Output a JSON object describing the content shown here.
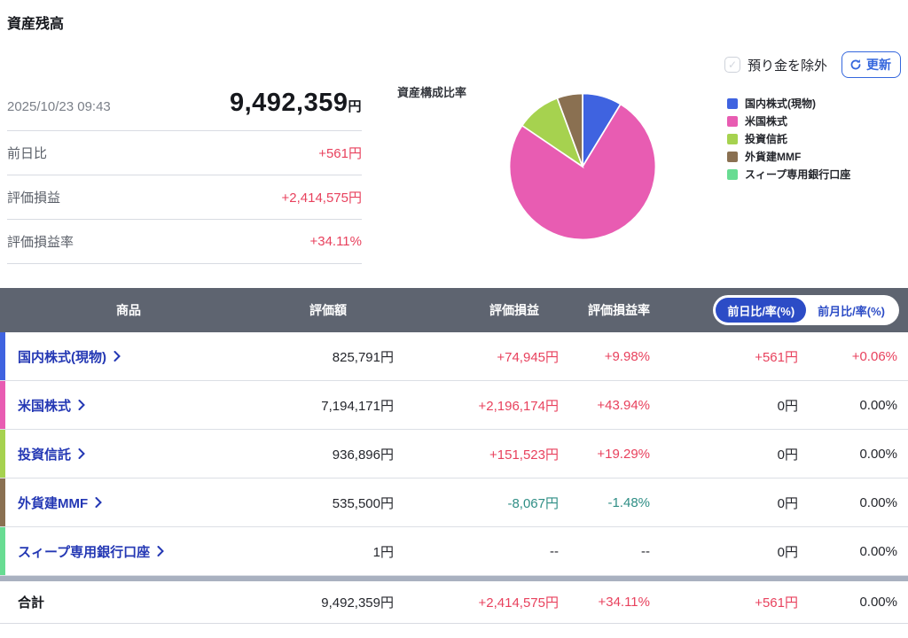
{
  "colors": {
    "positive": "#e8415d",
    "negative": "#2f8e85",
    "link": "#2438b4",
    "accent-blue": "#3567dd",
    "pill-blue": "#2c4cc6",
    "header-bg": "#5e6470"
  },
  "page": {
    "title": "資産残高"
  },
  "controls": {
    "exclude_label": "預り金を除外",
    "refresh_label": "更新"
  },
  "summary": {
    "datetime": "2025/10/23 09:43",
    "total_amount": "9,492,359",
    "currency_suffix": "円",
    "rows": [
      {
        "label": "前日比",
        "value": "+561円",
        "tone": "pos"
      },
      {
        "label": "評価損益",
        "value": "+2,414,575円",
        "tone": "pos"
      },
      {
        "label": "評価損益率",
        "value": "+34.11%",
        "tone": "pos"
      }
    ]
  },
  "chart_data": {
    "type": "pie",
    "title": "資産構成比率",
    "legend_position": "right",
    "start_angle_deg": -90,
    "direction": "clockwise",
    "slices": [
      {
        "label": "国内株式(現物)",
        "value": 825791,
        "percent": 8.7,
        "color": "#3f63e0"
      },
      {
        "label": "米国株式",
        "value": 7194171,
        "percent": 75.8,
        "color": "#e85cb2"
      },
      {
        "label": "投資信託",
        "value": 936896,
        "percent": 9.9,
        "color": "#a6d24f"
      },
      {
        "label": "外貨建MMF",
        "value": 535500,
        "percent": 5.6,
        "color": "#8a7051"
      },
      {
        "label": "スィープ専用銀行口座",
        "value": 1,
        "percent": 0.0,
        "color": "#68dc92"
      }
    ]
  },
  "table": {
    "headers": {
      "product": "商品",
      "value": "評価額",
      "pl": "評価損益",
      "pl_rate": "評価損益率"
    },
    "toggle": {
      "active_label": "前日比/率(%)",
      "inactive_label": "前月比/率(%)"
    },
    "rows": [
      {
        "name": "国内株式(現物)",
        "color": "#3f63e0",
        "value": "825,791円",
        "pl": "+74,945円",
        "pl_tone": "pos",
        "rate": "+9.98%",
        "rate_tone": "pos",
        "day": "+561円",
        "day_tone": "pos",
        "drate": "+0.06%",
        "drate_tone": "pos"
      },
      {
        "name": "米国株式",
        "color": "#e85cb2",
        "value": "7,194,171円",
        "pl": "+2,196,174円",
        "pl_tone": "pos",
        "rate": "+43.94%",
        "rate_tone": "pos",
        "day": "0円",
        "day_tone": "neu",
        "drate": "0.00%",
        "drate_tone": "neu"
      },
      {
        "name": "投資信託",
        "color": "#a6d24f",
        "value": "936,896円",
        "pl": "+151,523円",
        "pl_tone": "pos",
        "rate": "+19.29%",
        "rate_tone": "pos",
        "day": "0円",
        "day_tone": "neu",
        "drate": "0.00%",
        "drate_tone": "neu"
      },
      {
        "name": "外貨建MMF",
        "color": "#8a7051",
        "value": "535,500円",
        "pl": "-8,067円",
        "pl_tone": "neg",
        "rate": "-1.48%",
        "rate_tone": "neg",
        "day": "0円",
        "day_tone": "neu",
        "drate": "0.00%",
        "drate_tone": "neu"
      },
      {
        "name": "スィープ専用銀行口座",
        "color": "#68dc92",
        "value": "1円",
        "pl": "--",
        "pl_tone": "neu",
        "rate": "--",
        "rate_tone": "neu",
        "day": "0円",
        "day_tone": "neu",
        "drate": "0.00%",
        "drate_tone": "neu"
      }
    ],
    "total": {
      "label": "合計",
      "value": "9,492,359円",
      "pl": "+2,414,575円",
      "pl_tone": "pos",
      "rate": "+34.11%",
      "rate_tone": "pos",
      "day": "+561円",
      "day_tone": "pos",
      "drate": "0.00%",
      "drate_tone": "neu"
    }
  }
}
